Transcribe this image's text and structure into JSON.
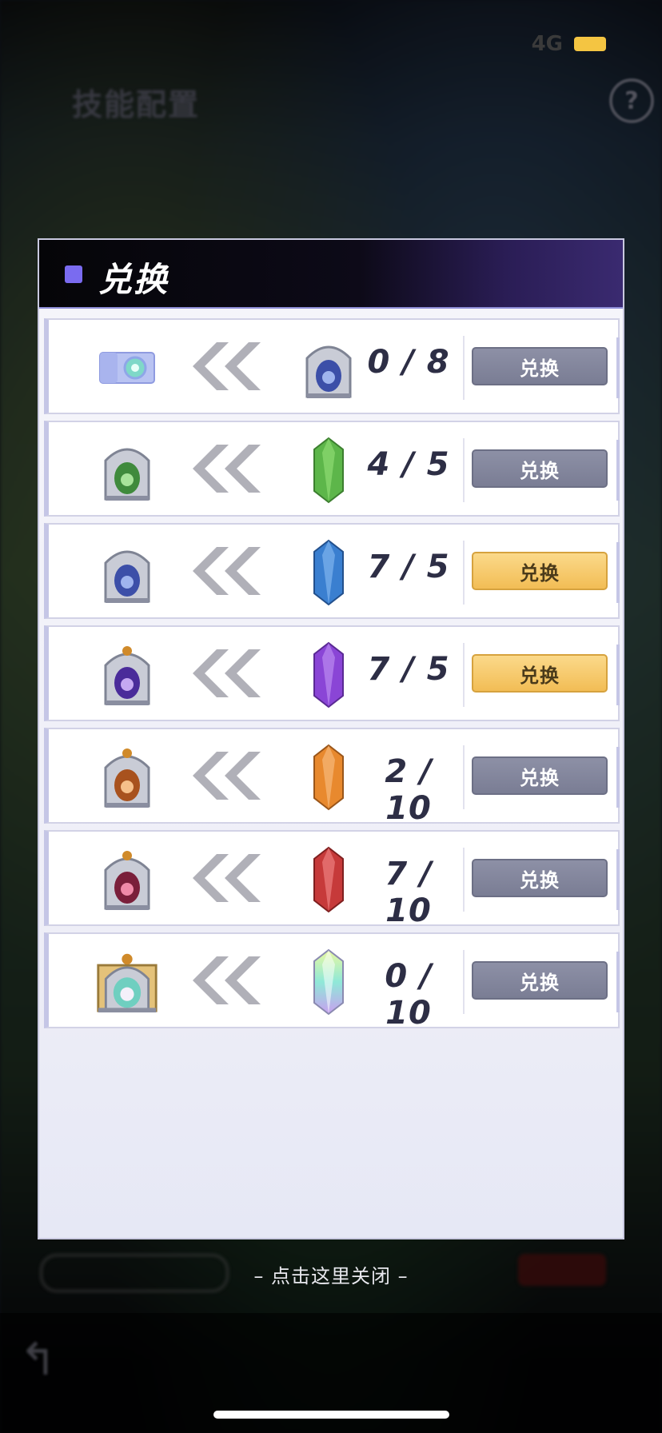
{
  "status_bar": {
    "network": "4G"
  },
  "background": {
    "title": "技能配置",
    "help_icon": "question-icon"
  },
  "modal": {
    "title": "兑换",
    "rows": [
      {
        "from_item": "blue-ticket",
        "to_item": "blue-gate-tier1",
        "count": "0 / 8",
        "button": "兑换",
        "button_state": "disabled"
      },
      {
        "from_item": "green-gate",
        "to_item": "green-crystal",
        "count": "4 / 5",
        "button": "兑换",
        "button_state": "disabled"
      },
      {
        "from_item": "blue-gate",
        "to_item": "blue-crystal",
        "count": "7 / 5",
        "button": "兑换",
        "button_state": "active"
      },
      {
        "from_item": "purple-gate",
        "to_item": "purple-crystal",
        "count": "7 / 5",
        "button": "兑换",
        "button_state": "active"
      },
      {
        "from_item": "orange-gate",
        "to_item": "orange-crystal",
        "count": "2 / 10",
        "button": "兑换",
        "button_state": "disabled"
      },
      {
        "from_item": "red-gate",
        "to_item": "red-crystal",
        "count": "7 / 10",
        "button": "兑换",
        "button_state": "disabled"
      },
      {
        "from_item": "rainbow-gate",
        "to_item": "rainbow-crystal",
        "count": "0 / 10",
        "button": "兑换",
        "button_state": "disabled"
      }
    ]
  },
  "close_hint": "– 点击这里关闭 –",
  "colors": {
    "accent": "#7a6bf0",
    "button_gray": "#7a7d94",
    "button_gold": "#f2bd55",
    "green": "#5db64a",
    "blue": "#3a7fd0",
    "purple": "#8a45d6",
    "orange": "#e8892e",
    "red": "#c63a3a"
  }
}
